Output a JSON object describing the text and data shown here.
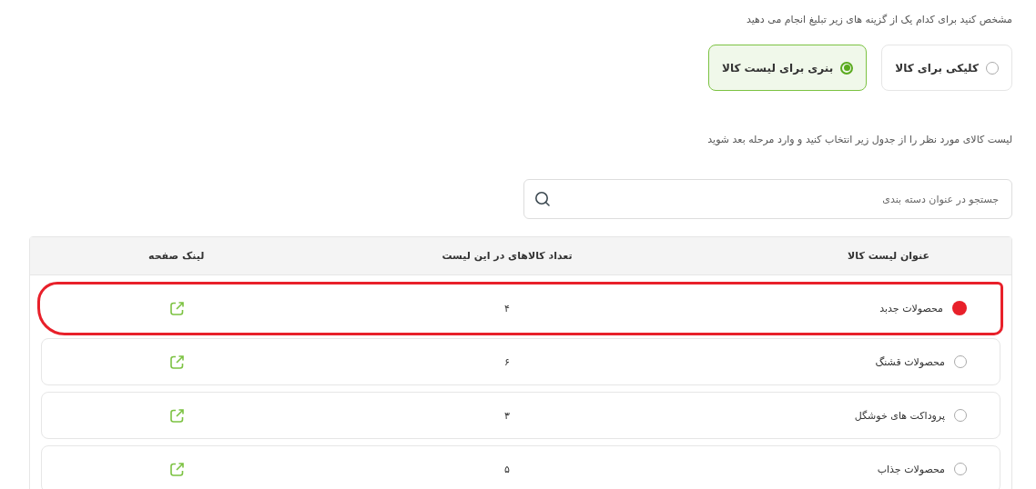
{
  "prompt": "مشخص کنید برای کدام یک از گزینه های زیر تبلیغ انجام می دهید",
  "ad_types": [
    {
      "label": "کلیکی برای کالا",
      "selected": false
    },
    {
      "label": "بنری برای لیست کالا",
      "selected": true
    }
  ],
  "instruction": "لیست کالای مورد نظر را از جدول زیر انتخاب کنید و وارد مرحله بعد شوید",
  "search": {
    "placeholder": "جستجو در عنوان دسته بندی"
  },
  "table": {
    "columns": [
      "عنوان لیست کالا",
      "تعداد کالاهای در این لیست",
      "لینک صفحه"
    ],
    "rows": [
      {
        "title": "محصولات جدبد",
        "count": "۴",
        "selected": true,
        "highlighted": true
      },
      {
        "title": "محصولات قشنگ",
        "count": "۶",
        "selected": false,
        "highlighted": false
      },
      {
        "title": "پروداکت های خوشگل",
        "count": "۳",
        "selected": false,
        "highlighted": false
      },
      {
        "title": "محصولات جذاب",
        "count": "۵",
        "selected": false,
        "highlighted": false
      }
    ]
  }
}
